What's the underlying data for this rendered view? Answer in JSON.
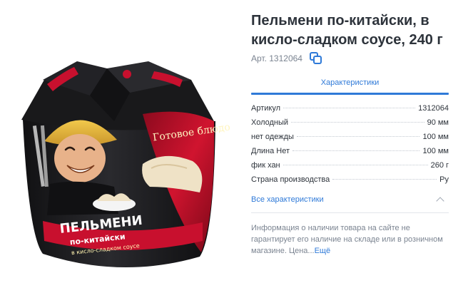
{
  "product": {
    "title": "Пельмени по-китайски, в кисло-сладком соусе, 240 г",
    "article": "Арт. 1312064",
    "image_alt": "product-photo",
    "package_text_1": "Готовое блюдо",
    "package_text_2": "ПЕЛЬМЕНИ",
    "package_text_3": "по-китайски",
    "package_text_4": "в кисло-сладком соусе"
  },
  "tabs": {
    "characteristics": "Характеристики"
  },
  "specs": [
    {
      "label": "Артикул",
      "value": "1312064"
    },
    {
      "label": "Холодный",
      "value": "90 мм"
    },
    {
      "label": "нет одежды",
      "value": "100 мм"
    },
    {
      "label": "Длина Нет",
      "value": "100 мм"
    },
    {
      "label": "фик хан",
      "value": "260 г"
    },
    {
      "label": "Страна производства",
      "value": "Ру"
    }
  ],
  "all_characteristics": "Все характеристики",
  "notice": {
    "text": "Информация о наличии товара на сайте не гарантирует его наличие на складе или в розничном магазине. Цена...",
    "more": "Ещё"
  },
  "colors": {
    "accent": "#2f7ad8",
    "muted": "#7b8491",
    "package_dark": "#1b1b1d",
    "package_red": "#c8102e"
  },
  "icons": {
    "copy": "copy-icon",
    "chevron": "chevron-up-icon"
  }
}
